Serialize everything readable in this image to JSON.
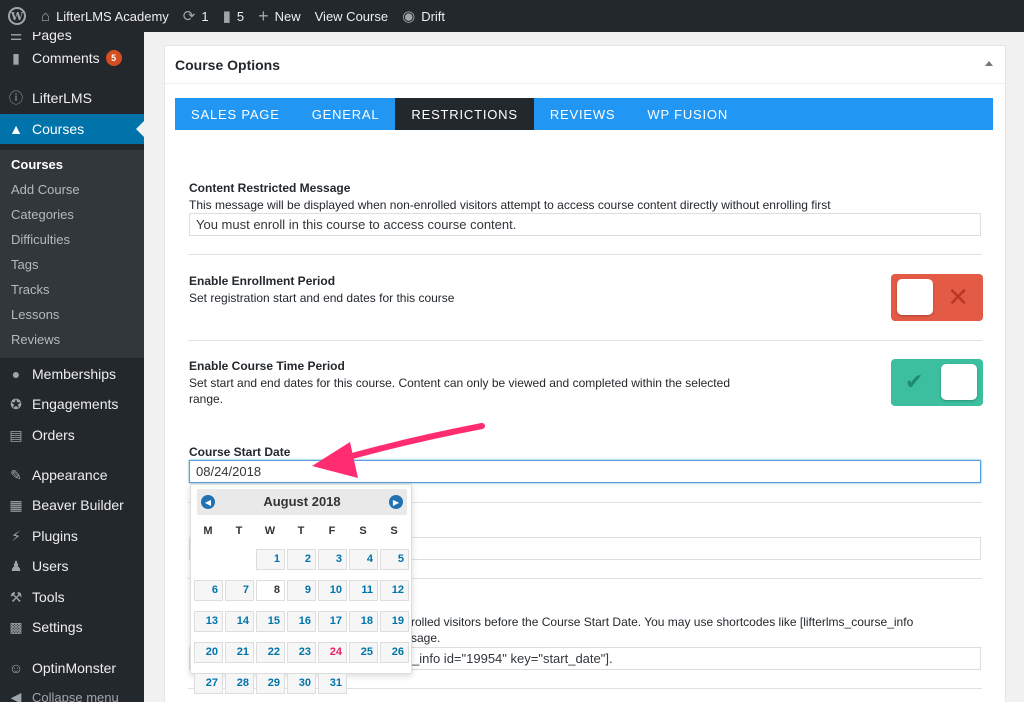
{
  "admin_bar": {
    "site_name": "LifterLMS Academy",
    "updates_count": "1",
    "comments_count": "5",
    "new_label": "New",
    "view_label": "View Course",
    "drift_label": "Drift"
  },
  "sidebar": {
    "top_partial": "Pages",
    "comments": {
      "label": "Comments",
      "badge": "5"
    },
    "lifterlms": "LifterLMS",
    "courses": "Courses",
    "submenu": [
      "Courses",
      "Add Course",
      "Categories",
      "Difficulties",
      "Tags",
      "Tracks",
      "Lessons",
      "Reviews"
    ],
    "items_after": [
      "Memberships",
      "Engagements",
      "Orders",
      "Appearance",
      "Beaver Builder",
      "Plugins",
      "Users",
      "Tools",
      "Settings",
      "OptinMonster",
      "Collapse menu"
    ]
  },
  "postbox": {
    "title": "Course Options",
    "tabs": [
      "SALES PAGE",
      "GENERAL",
      "RESTRICTIONS",
      "REVIEWS",
      "WP FUSION"
    ],
    "active_tab": "RESTRICTIONS"
  },
  "fields": {
    "restricted": {
      "label": "Content Restricted Message",
      "desc": "This message will be displayed when non-enrolled visitors attempt to access course content directly without enrolling first",
      "value": "You must enroll in this course to access course content."
    },
    "enrollment_period": {
      "label": "Enable Enrollment Period",
      "desc": "Set registration start and end dates for this course",
      "enabled": false
    },
    "time_period": {
      "label": "Enable Course Time Period",
      "desc": "Set start and end dates for this course. Content can only be viewed and completed within the selected range.",
      "enabled": true
    },
    "start_date": {
      "label": "Course Start Date",
      "value": "08/24/2018"
    },
    "hidden_desc_line1": "rolled visitors before the Course Start Date. You may use shortcodes like [lifterlms_course_info",
    "hidden_desc_line2": "sage.",
    "hidden_value": "_info id=\"19954\" key=\"start_date\"]."
  },
  "datepicker": {
    "month": "August 2018",
    "weekdays": [
      "M",
      "T",
      "W",
      "T",
      "F",
      "S",
      "S"
    ],
    "days": [
      "1",
      "2",
      "3",
      "4",
      "5",
      "6",
      "7",
      "8",
      "9",
      "10",
      "11",
      "12",
      "13",
      "14",
      "15",
      "16",
      "17",
      "18",
      "19",
      "20",
      "21",
      "22",
      "23",
      "24",
      "25",
      "26",
      "27",
      "28",
      "29",
      "30",
      "31"
    ],
    "today": "8",
    "selected": "24"
  },
  "colors": {
    "accent": "#2196f3",
    "wp_blue": "#0073aa",
    "switch_off": "#e35b45",
    "switch_on": "#3bbf9f",
    "arrow": "#ff2d6f"
  }
}
